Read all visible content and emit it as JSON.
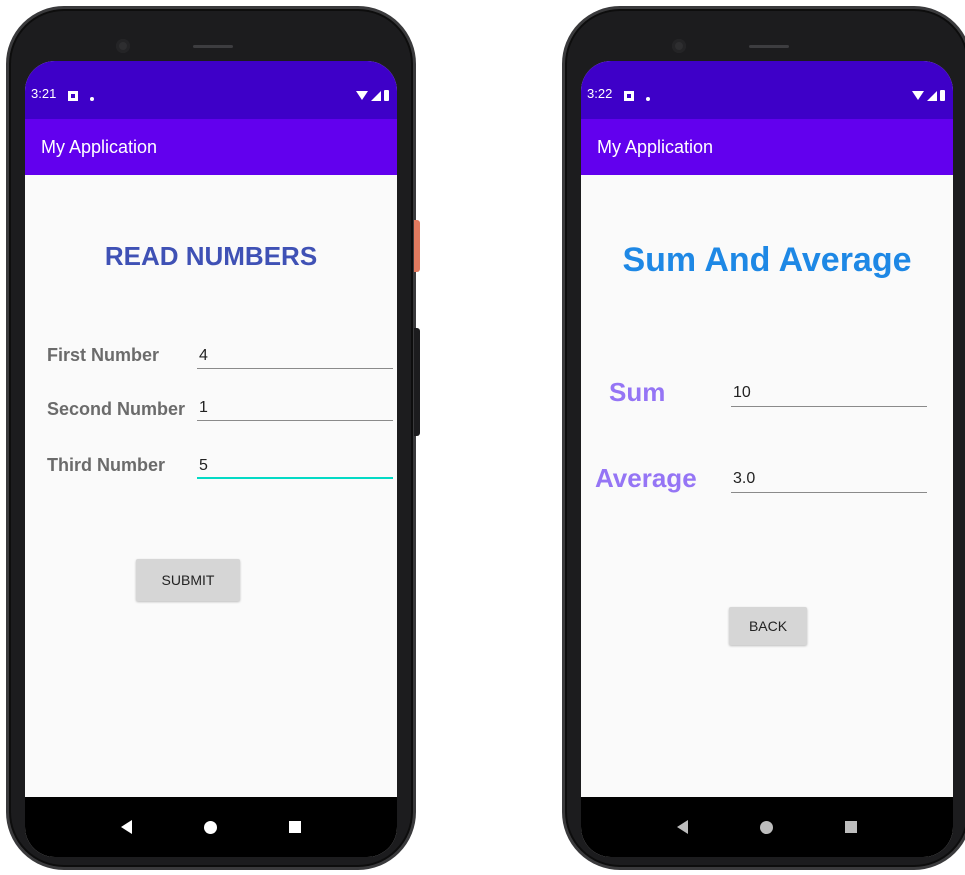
{
  "left_phone": {
    "status": {
      "time": "3:21"
    },
    "app_title": "My Application",
    "heading": "READ NUMBERS",
    "fields": [
      {
        "label": "First Number",
        "value": "4"
      },
      {
        "label": "Second Number",
        "value": "1"
      },
      {
        "label": "Third Number",
        "value": "5"
      }
    ],
    "submit_label": "SUBMIT"
  },
  "right_phone": {
    "status": {
      "time": "3:22"
    },
    "app_title": "My Application",
    "heading": "Sum And Average",
    "results": [
      {
        "label": "Sum",
        "value": "10"
      },
      {
        "label": "Average",
        "value": "3.0"
      }
    ],
    "back_label": "BACK"
  },
  "colors": {
    "status_bar": "#3e00c8",
    "app_bar": "#6200ee",
    "heading_read": "#3f51b5",
    "heading_sum": "#1e88e5",
    "result_label": "#9575f5",
    "focus_underline": "#03dac5"
  }
}
